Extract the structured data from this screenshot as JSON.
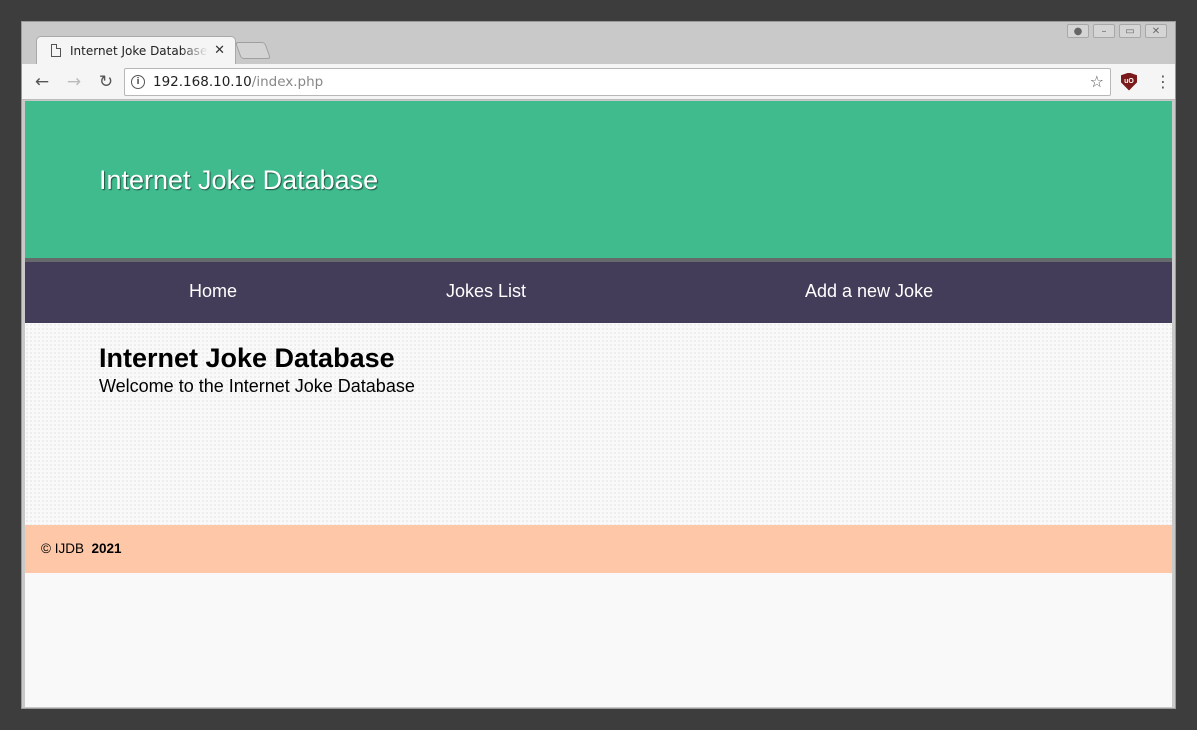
{
  "browser": {
    "tab_title": "Internet Joke Database",
    "url_host": "192.168.10.10",
    "url_path": "/index.php"
  },
  "site": {
    "header_title": "Internet Joke Database",
    "nav": [
      {
        "label": "Home"
      },
      {
        "label": "Jokes List"
      },
      {
        "label": "Add a new Joke"
      }
    ],
    "main": {
      "heading": "Internet Joke Database",
      "text": "Welcome to the Internet Joke Database"
    },
    "footer": {
      "prefix": "© IJDB",
      "year": "2021"
    }
  },
  "colors": {
    "header_bg": "#3fbb8e",
    "nav_bg": "#443d5a",
    "footer_bg": "#fec8a8"
  }
}
